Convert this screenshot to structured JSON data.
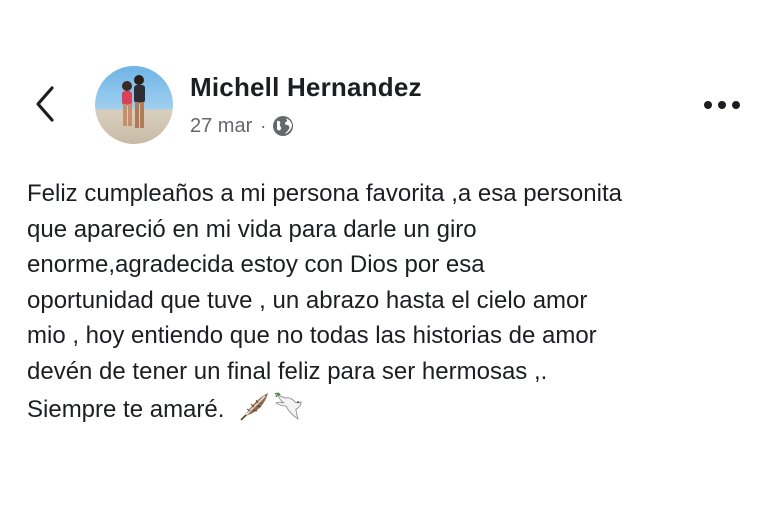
{
  "post": {
    "author": "Michell Hernandez",
    "date": "27 mar",
    "separator": "·",
    "privacy_icon": "globe-icon",
    "lines": [
      "Feliz cumpleaños a mi persona favorita ,a esa personita",
      "que apareció en mi vida para darle un giro",
      "enorme,agradecida estoy con Dios por esa",
      "oportunidad que tuve , un abrazo hasta el cielo  amor",
      "mio , hoy entiendo que no todas las historias de amor",
      "devén de tener un final feliz para ser hermosas ,.",
      "Siempre te amaré."
    ],
    "emojis": [
      "feather-icon",
      "dove-icon"
    ]
  },
  "header": {
    "back_icon": "chevron-left-icon",
    "more_icon": "more-dots-icon"
  },
  "colors": {
    "text": "#1c1e21",
    "secondary": "#65676b",
    "background": "#ffffff"
  }
}
